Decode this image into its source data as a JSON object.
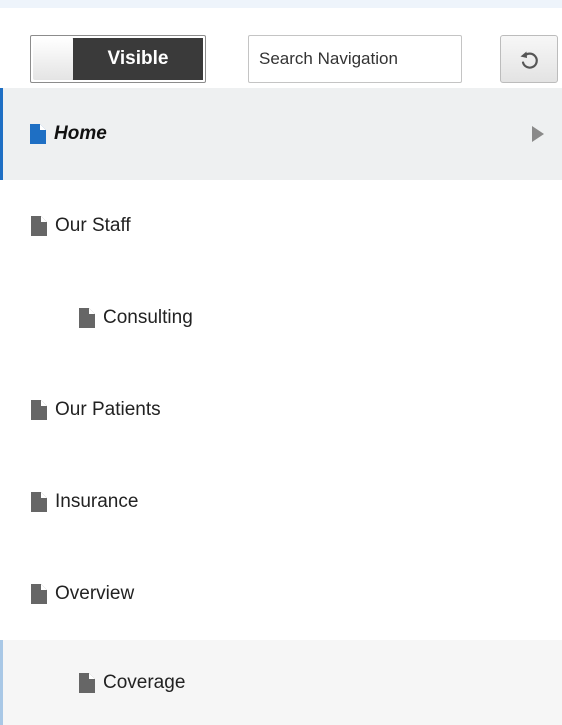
{
  "toolbar": {
    "toggle_label": "Visible",
    "search_placeholder": "Search Navigation",
    "refresh_icon": "refresh-icon"
  },
  "nav": {
    "items": [
      {
        "label": "Home",
        "level": 0,
        "state": "selected",
        "icon": "page-icon",
        "has_children": true
      },
      {
        "label": "Our Staff",
        "level": 0,
        "state": "normal",
        "icon": "page-icon"
      },
      {
        "label": "Consulting",
        "level": 1,
        "state": "normal",
        "icon": "page-icon"
      },
      {
        "label": "Our Patients",
        "level": 0,
        "state": "normal",
        "icon": "page-icon"
      },
      {
        "label": "Insurance",
        "level": 0,
        "state": "normal",
        "icon": "page-icon"
      },
      {
        "label": "Overview",
        "level": 0,
        "state": "normal",
        "icon": "page-icon"
      },
      {
        "label": "Coverage",
        "level": 1,
        "state": "hovered",
        "icon": "page-icon"
      }
    ]
  },
  "colors": {
    "selected_accent": "#1e6fc4",
    "hover_accent": "#a9c8e6",
    "selected_icon": "#1e6fc4",
    "default_icon": "#666666",
    "toggle_on_bg": "#3a3a3a"
  }
}
